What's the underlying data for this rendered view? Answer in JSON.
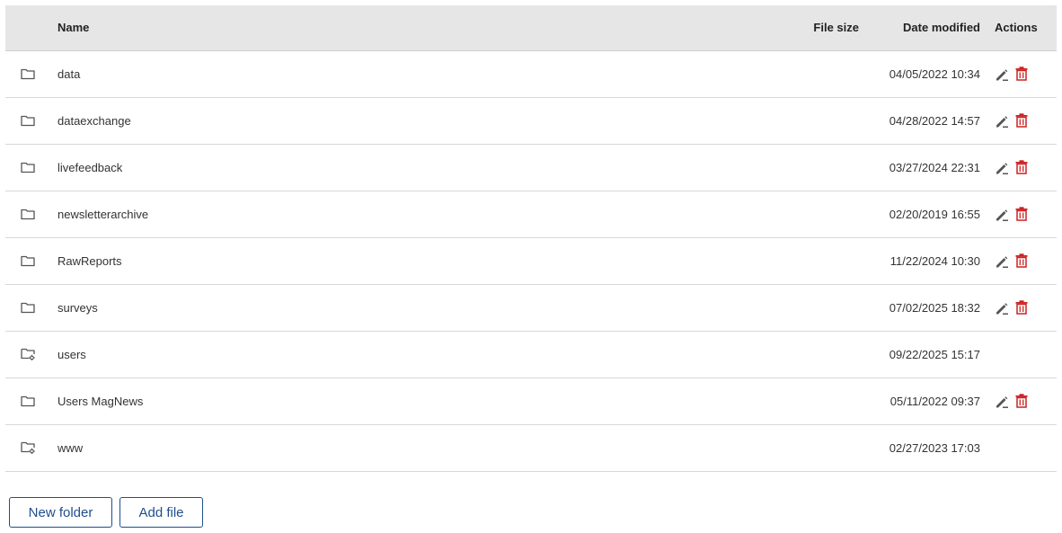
{
  "table": {
    "headers": {
      "name": "Name",
      "size": "File size",
      "date": "Date modified",
      "actions": "Actions"
    },
    "rows": [
      {
        "icon": "folder-icon",
        "name": "data",
        "size": "",
        "date": "04/05/2022 10:34",
        "editable": true
      },
      {
        "icon": "folder-icon",
        "name": "dataexchange",
        "size": "",
        "date": "04/28/2022 14:57",
        "editable": true
      },
      {
        "icon": "folder-icon",
        "name": "livefeedback",
        "size": "",
        "date": "03/27/2024 22:31",
        "editable": true
      },
      {
        "icon": "folder-icon",
        "name": "newsletterarchive",
        "size": "",
        "date": "02/20/2019 16:55",
        "editable": true
      },
      {
        "icon": "folder-icon",
        "name": "RawReports",
        "size": "",
        "date": "11/22/2024 10:30",
        "editable": true
      },
      {
        "icon": "folder-icon",
        "name": "surveys",
        "size": "",
        "date": "07/02/2025 18:32",
        "editable": true
      },
      {
        "icon": "system-folder-icon",
        "name": "users",
        "size": "",
        "date": "09/22/2025 15:17",
        "editable": false
      },
      {
        "icon": "folder-icon",
        "name": "Users MagNews",
        "size": "",
        "date": "05/11/2022 09:37",
        "editable": true
      },
      {
        "icon": "system-folder-icon",
        "name": "www",
        "size": "",
        "date": "02/27/2023 17:03",
        "editable": false
      }
    ]
  },
  "buttons": {
    "new_folder": "New folder",
    "add_file": "Add file"
  },
  "colors": {
    "header_bg": "#e6e6e6",
    "delete": "#cc2222",
    "edit": "#555555",
    "button": "#1f4e8c"
  }
}
